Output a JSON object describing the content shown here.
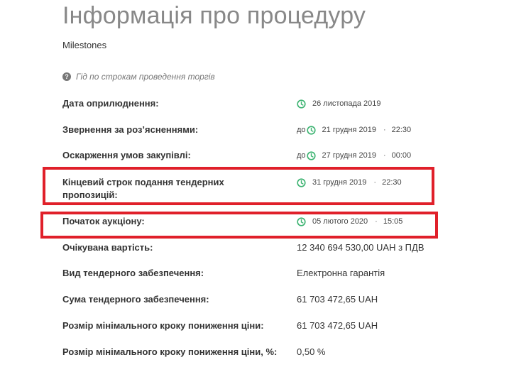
{
  "header": {
    "title": "Інформація про процедуру",
    "subtitle": "Milestones"
  },
  "help": {
    "icon": "question-circle-icon",
    "text": "Гід по строкам проведення торгів"
  },
  "colors": {
    "clock": "#3cb371",
    "highlight": "#e0202a"
  },
  "rows": [
    {
      "label": "Дата оприлюднення:",
      "prefix": "",
      "date": "26 листопада 2019",
      "time": ""
    },
    {
      "label": "Звернення за роз’ясненнями:",
      "prefix": "до",
      "date": "21 грудня 2019",
      "time": "22:30"
    },
    {
      "label": "Оскарження умов закупівлі:",
      "prefix": "до",
      "date": "27 грудня 2019",
      "time": "00:00"
    },
    {
      "label": "Кінцевий строк подання тендерних пропозицій:",
      "prefix": "",
      "date": "31 грудня 2019",
      "time": "22:30"
    },
    {
      "label": "Початок аукціону:",
      "prefix": "",
      "date": "05 лютого 2020",
      "time": "15:05"
    },
    {
      "label": "Очікувана вартість:",
      "value": "12 340 694 530,00 UAH з ПДВ"
    },
    {
      "label": "Вид тендерного забезпечення:",
      "value": "Електронна гарантія"
    },
    {
      "label": "Сума тендерного забезпечення:",
      "value": "61 703 472,65 UAH"
    },
    {
      "label": "Розмір мінімального кроку пониження ціни:",
      "value": "61 703 472,65 UAH"
    },
    {
      "label": "Розмір мінімального кроку пониження ціни, %:",
      "value": "0,50 %"
    }
  ]
}
